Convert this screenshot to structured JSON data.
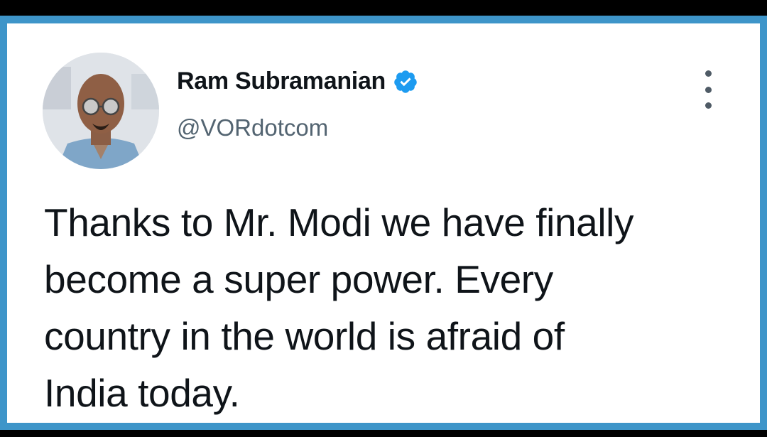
{
  "tweet": {
    "author": {
      "display_name": "Ram Subramanian",
      "handle": "@VORdotcom",
      "verified": true,
      "avatar_icon": "profile-photo"
    },
    "text": "Thanks to Mr. Modi we have finally\nbecome a super power. Every\ncountry in the world is afraid of\nIndia today.",
    "more_icon": "vertical-ellipsis-icon"
  },
  "colors": {
    "frame_border": "#3e95c9",
    "background_bar": "#000000",
    "verified_badge": "#1d9bf0",
    "text_primary": "#0f1419",
    "text_secondary": "#536471"
  }
}
